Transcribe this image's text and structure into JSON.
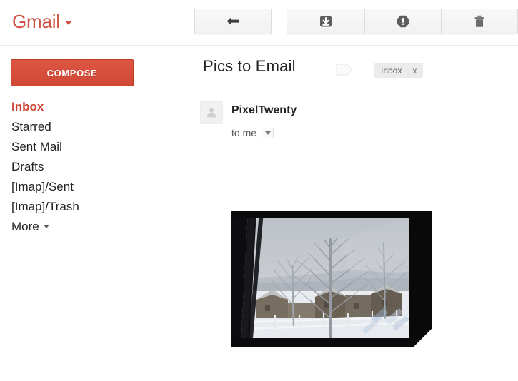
{
  "header": {
    "logo_text": "Gmail",
    "logo_color": "#cf5344",
    "logo_caret_icon": "chevron-down-icon",
    "toolbar": {
      "back_icon": "back-arrow-icon",
      "archive_icon": "archive-icon",
      "spam_icon": "report-spam-icon",
      "delete_icon": "trash-icon"
    }
  },
  "sidebar": {
    "compose_label": "COMPOSE",
    "compose_color": "#d14836",
    "items": [
      {
        "label": "Inbox",
        "active": true
      },
      {
        "label": "Starred",
        "active": false
      },
      {
        "label": "Sent Mail",
        "active": false
      },
      {
        "label": "Drafts",
        "active": false
      },
      {
        "label": "[Imap]/Sent",
        "active": false
      },
      {
        "label": "[Imap]/Trash",
        "active": false
      },
      {
        "label": "More",
        "active": false
      }
    ],
    "more_caret_icon": "chevron-down-icon",
    "active_color": "#cf4436"
  },
  "main": {
    "subject": "Pics to Email",
    "label_tag_icon": "label-tag-icon",
    "chip": {
      "label": "Inbox",
      "remove_label": "x"
    },
    "message": {
      "avatar_icon": "person-avatar-icon",
      "sender": "PixelTwenty",
      "recipient": "to me",
      "details_caret_icon": "chevron-down-icon"
    },
    "attachment": {
      "name": "photo-attachment",
      "description": "Snowy winter scene photographed through a window: bare trees, houses and a white fence under an overcast sky"
    }
  }
}
